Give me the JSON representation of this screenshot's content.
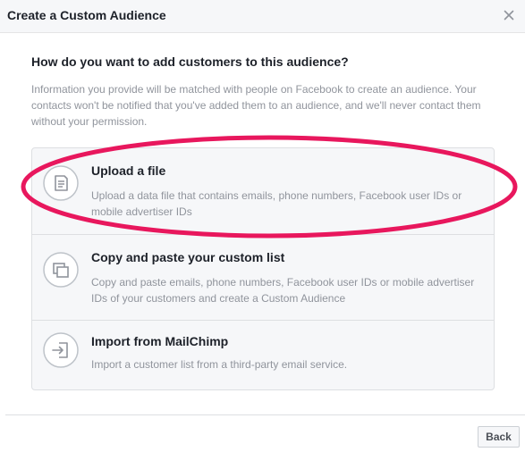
{
  "dialog": {
    "title": "Create a Custom Audience"
  },
  "content": {
    "question": "How do you want to add customers to this audience?",
    "info": "Information you provide will be matched with people on Facebook to create an audience. Your contacts won't be notified that you've added them to an audience, and we'll never contact them without your permission."
  },
  "options": [
    {
      "icon": "document-icon",
      "title": "Upload a file",
      "description": "Upload a data file that contains emails, phone numbers, Facebook user IDs or mobile advertiser IDs"
    },
    {
      "icon": "copy-icon",
      "title": "Copy and paste your custom list",
      "description": "Copy and paste emails, phone numbers, Facebook user IDs or mobile advertiser IDs of your customers and create a Custom Audience"
    },
    {
      "icon": "import-icon",
      "title": "Import from MailChimp",
      "description": "Import a customer list from a third-party email service."
    }
  ],
  "footer": {
    "back_label": "Back"
  },
  "colors": {
    "highlight": "#e8175d",
    "header_bg": "#f6f7f9",
    "option_bg": "#f6f7f9",
    "text_primary": "#1d2129",
    "text_secondary": "#90949c"
  }
}
